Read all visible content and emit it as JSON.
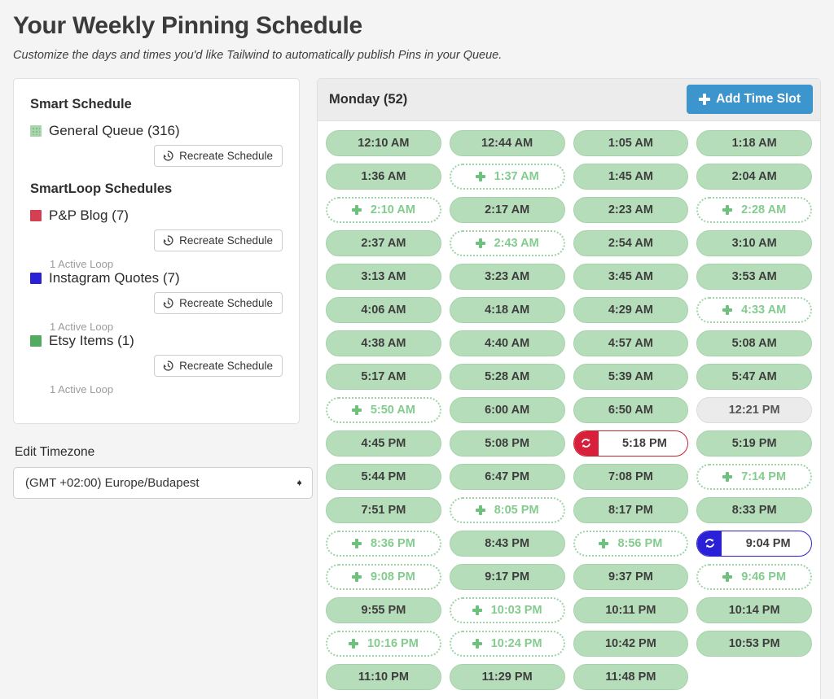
{
  "header": {
    "title": "Your Weekly Pinning Schedule",
    "subtitle": "Customize the days and times you'd like Tailwind to automatically publish Pins in your Queue."
  },
  "sidebar": {
    "smart_schedule_heading": "Smart Schedule",
    "smartloop_heading": "SmartLoop Schedules",
    "recreate_label": "Recreate Schedule",
    "active_loop_label": "1 Active Loop",
    "smart_schedule": [
      {
        "label": "General Queue (316)",
        "color": "#a8d5ab",
        "dotted": true,
        "recreate": "Recreate Schedule",
        "active_loop": ""
      }
    ],
    "smartloop": [
      {
        "label": "P&P Blog (7)",
        "color": "#d43f52",
        "dotted": false,
        "recreate": "Recreate Schedule",
        "active_loop": "1 Active Loop"
      },
      {
        "label": "Instagram Quotes (7)",
        "color": "#2a21d6",
        "dotted": false,
        "recreate": "Recreate Schedule",
        "active_loop": "1 Active Loop"
      },
      {
        "label": "Etsy Items (1)",
        "color": "#52ab5e",
        "dotted": false,
        "recreate": "Recreate Schedule",
        "active_loop": "1 Active Loop"
      }
    ],
    "timezone": {
      "label": "Edit Timezone",
      "value": "(GMT +02:00) Europe/Budapest"
    }
  },
  "schedule_panel": {
    "day_title": "Monday (52)",
    "add_time_slot_label": "Add Time Slot",
    "accent_color": "#3d95ce",
    "slots": [
      {
        "time": "12:10 AM",
        "state": "filled"
      },
      {
        "time": "12:44 AM",
        "state": "filled"
      },
      {
        "time": "1:05 AM",
        "state": "filled"
      },
      {
        "time": "1:18 AM",
        "state": "filled"
      },
      {
        "time": "1:36 AM",
        "state": "filled"
      },
      {
        "time": "1:37 AM",
        "state": "empty"
      },
      {
        "time": "1:45 AM",
        "state": "filled"
      },
      {
        "time": "2:04 AM",
        "state": "filled"
      },
      {
        "time": "2:10 AM",
        "state": "empty"
      },
      {
        "time": "2:17 AM",
        "state": "filled"
      },
      {
        "time": "2:23 AM",
        "state": "filled"
      },
      {
        "time": "2:28 AM",
        "state": "empty"
      },
      {
        "time": "2:37 AM",
        "state": "filled"
      },
      {
        "time": "2:43 AM",
        "state": "empty"
      },
      {
        "time": "2:54 AM",
        "state": "filled"
      },
      {
        "time": "3:10 AM",
        "state": "filled"
      },
      {
        "time": "3:13 AM",
        "state": "filled"
      },
      {
        "time": "3:23 AM",
        "state": "filled"
      },
      {
        "time": "3:45 AM",
        "state": "filled"
      },
      {
        "time": "3:53 AM",
        "state": "filled"
      },
      {
        "time": "4:06 AM",
        "state": "filled"
      },
      {
        "time": "4:18 AM",
        "state": "filled"
      },
      {
        "time": "4:29 AM",
        "state": "filled"
      },
      {
        "time": "4:33 AM",
        "state": "empty"
      },
      {
        "time": "4:38 AM",
        "state": "filled"
      },
      {
        "time": "4:40 AM",
        "state": "filled"
      },
      {
        "time": "4:57 AM",
        "state": "filled"
      },
      {
        "time": "5:08 AM",
        "state": "filled"
      },
      {
        "time": "5:17 AM",
        "state": "filled"
      },
      {
        "time": "5:28 AM",
        "state": "filled"
      },
      {
        "time": "5:39 AM",
        "state": "filled"
      },
      {
        "time": "5:47 AM",
        "state": "filled"
      },
      {
        "time": "5:50 AM",
        "state": "empty"
      },
      {
        "time": "6:00 AM",
        "state": "filled"
      },
      {
        "time": "6:50 AM",
        "state": "filled"
      },
      {
        "time": "12:21 PM",
        "state": "disabled"
      },
      {
        "time": "4:45 PM",
        "state": "filled"
      },
      {
        "time": "5:08 PM",
        "state": "filled"
      },
      {
        "time": "5:18 PM",
        "state": "loop",
        "loop_color": "#d8203a",
        "icon": "loop-icon"
      },
      {
        "time": "5:19 PM",
        "state": "filled"
      },
      {
        "time": "5:44 PM",
        "state": "filled"
      },
      {
        "time": "6:47 PM",
        "state": "filled"
      },
      {
        "time": "7:08 PM",
        "state": "filled"
      },
      {
        "time": "7:14 PM",
        "state": "empty"
      },
      {
        "time": "7:51 PM",
        "state": "filled"
      },
      {
        "time": "8:05 PM",
        "state": "empty"
      },
      {
        "time": "8:17 PM",
        "state": "filled"
      },
      {
        "time": "8:33 PM",
        "state": "filled"
      },
      {
        "time": "8:36 PM",
        "state": "empty"
      },
      {
        "time": "8:43 PM",
        "state": "filled"
      },
      {
        "time": "8:56 PM",
        "state": "empty"
      },
      {
        "time": "9:04 PM",
        "state": "loop",
        "loop_color": "#2a21d6",
        "icon": "loop-icon"
      },
      {
        "time": "9:08 PM",
        "state": "empty"
      },
      {
        "time": "9:17 PM",
        "state": "filled"
      },
      {
        "time": "9:37 PM",
        "state": "filled"
      },
      {
        "time": "9:46 PM",
        "state": "empty"
      },
      {
        "time": "9:55 PM",
        "state": "filled"
      },
      {
        "time": "10:03 PM",
        "state": "empty"
      },
      {
        "time": "10:11 PM",
        "state": "filled"
      },
      {
        "time": "10:14 PM",
        "state": "filled"
      },
      {
        "time": "10:16 PM",
        "state": "empty"
      },
      {
        "time": "10:24 PM",
        "state": "empty"
      },
      {
        "time": "10:42 PM",
        "state": "filled"
      },
      {
        "time": "10:53 PM",
        "state": "filled"
      },
      {
        "time": "11:10 PM",
        "state": "filled"
      },
      {
        "time": "11:29 PM",
        "state": "filled"
      },
      {
        "time": "11:48 PM",
        "state": "filled"
      }
    ]
  }
}
